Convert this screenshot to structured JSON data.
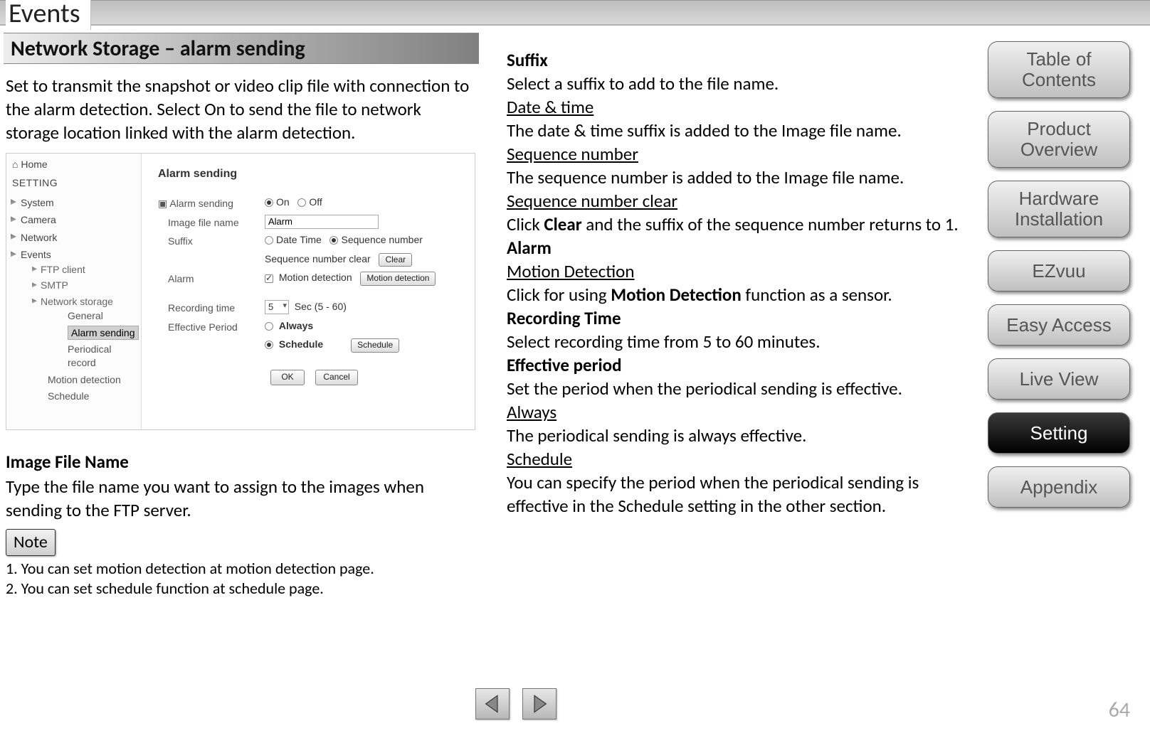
{
  "page_title": "Events",
  "section_header": "Network Storage – alarm sending",
  "intro": "Set to transmit the snapshot or video clip file with connection to the alarm detection. Select On to send the file to network storage location linked with the alarm detection.",
  "screenshot": {
    "home": "Home",
    "setting": "SETTING",
    "tree": {
      "system": "System",
      "camera": "Camera",
      "network": "Network",
      "events": "Events",
      "ftp": "FTP client",
      "smtp": "SMTP",
      "ns": "Network storage",
      "general": "General",
      "alarm_sending": "Alarm sending",
      "periodical": "Periodical record",
      "motion": "Motion detection",
      "schedule": "Schedule"
    },
    "form": {
      "panel_title": "Alarm sending",
      "alarm_sending_label": "Alarm sending",
      "on": "On",
      "off": "Off",
      "image_file_name_label": "Image file name",
      "image_file_name_value": "Alarm",
      "suffix_label": "Suffix",
      "date_time": "Date Time",
      "seq_num": "Sequence number",
      "seq_clear_label": "Sequence number clear",
      "clear_btn": "Clear",
      "alarm_label": "Alarm",
      "motion_detection": "Motion detection",
      "motion_detection_btn": "Motion detection",
      "recording_time_label": "Recording time",
      "recording_time_value": "5",
      "recording_time_unit": "Sec (5 - 60)",
      "effective_period_label": "Effective Period",
      "always": "Always",
      "schedule": "Schedule",
      "schedule_btn": "Schedule",
      "ok": "OK",
      "cancel": "Cancel"
    }
  },
  "left_bottom": {
    "h": "Image File Name",
    "p": "Type the file name you want to assign to the images when sending to the FTP server.",
    "note_label": "Note",
    "note1": "1. You can set motion detection at motion detection page.",
    "note2": "2. You can set schedule function at schedule page."
  },
  "right": {
    "suffix_h": "Suffix",
    "suffix_p": "Select a suffix to add to the file name.",
    "dt_u": "Date & time",
    "dt_p": "The date & time suffix is added to the Image file name.",
    "seq_u": "Sequence number",
    "seq_p": "The sequence number is added to the Image file name.",
    "seqc_u": "Sequence number clear",
    "seqc_p_a": "Click ",
    "seqc_p_b": "Clear",
    "seqc_p_c": " and the suffix of the sequence number returns to 1.",
    "alarm_h": "Alarm",
    "md_u": "Motion Detection",
    "md_p_a": "Click for using ",
    "md_p_b": "Motion Detection",
    "md_p_c": " function as a sensor.",
    "rec_h": "Recording Time",
    "rec_p": "Select recording time from 5 to 60 minutes.",
    "eff_h": "Effective period",
    "eff_p": "Set the period when the periodical sending is effective.",
    "always_u": "Always",
    "always_p": "The periodical sending is always effective.",
    "sched_u": "Schedule",
    "sched_p": "You can specify the period when the periodical sending is effective in the Schedule setting in the other section."
  },
  "nav": {
    "toc": "Table of Contents",
    "product": "Product Overview",
    "hardware": "Hardware Installation",
    "ezvuu": "EZvuu",
    "easy": "Easy Access",
    "live": "Live View",
    "setting": "Setting",
    "appendix": "Appendix"
  },
  "page_number": "64"
}
